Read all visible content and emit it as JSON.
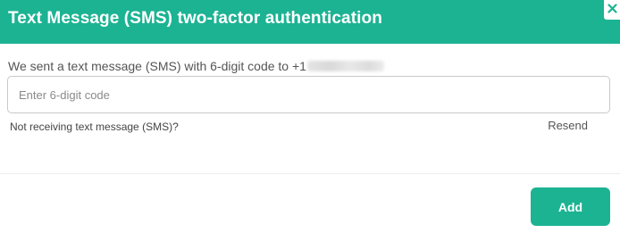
{
  "header": {
    "title": "Text Message (SMS) two-factor authentication",
    "close_icon": "close-icon"
  },
  "body": {
    "prompt_text": "We sent a text message (SMS) with 6-digit code to +1",
    "code_input": {
      "value": "",
      "placeholder": "Enter 6-digit code"
    },
    "help_text": "Not receiving text message (SMS)?",
    "resend_label": "Resend"
  },
  "footer": {
    "add_label": "Add"
  },
  "colors": {
    "accent": "#1cb393",
    "text": "#555555",
    "border": "#c9c9c9"
  }
}
